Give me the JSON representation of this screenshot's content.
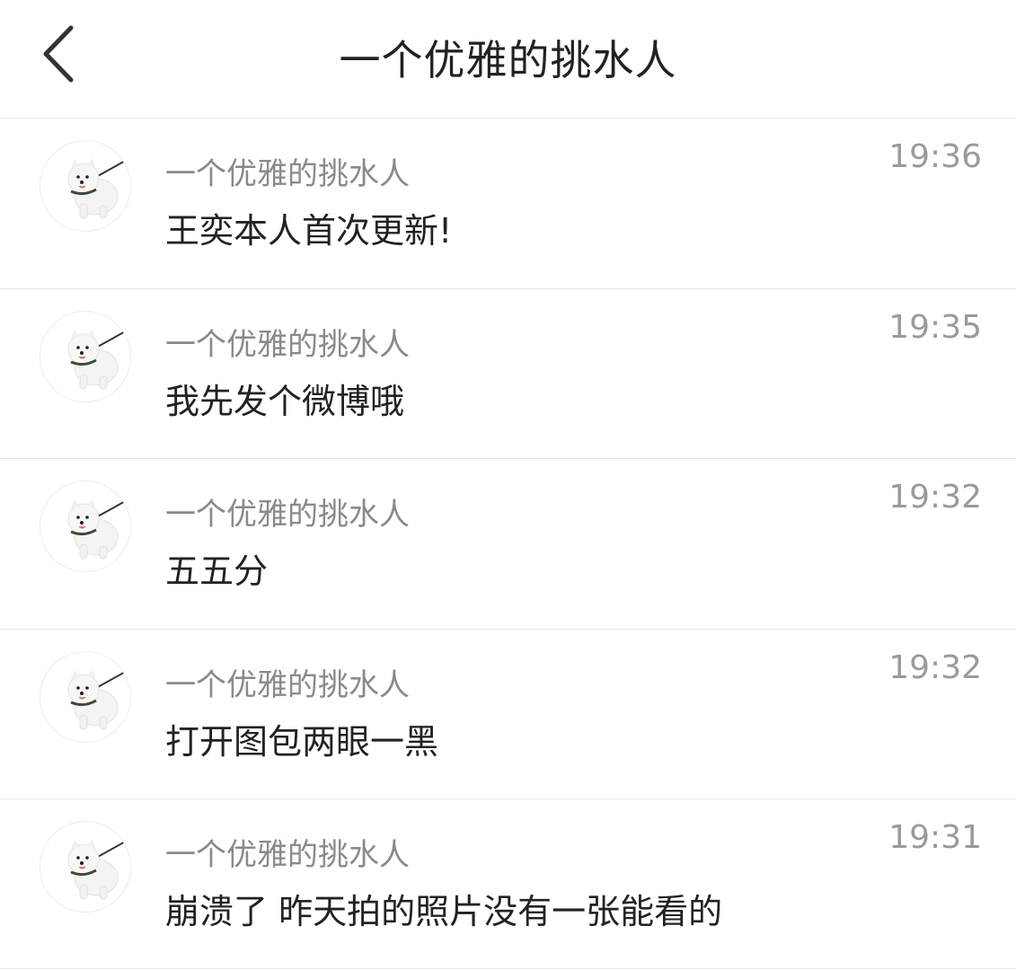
{
  "header": {
    "back_icon": "chevron-left-icon",
    "title": "一个优雅的挑水人"
  },
  "messages": [
    {
      "sender": "一个优雅的挑水人",
      "text": "王奕本人首次更新!",
      "time": "19:36",
      "avatar_icon": "white-dog-avatar-icon"
    },
    {
      "sender": "一个优雅的挑水人",
      "text": "我先发个微博哦",
      "time": "19:35",
      "avatar_icon": "white-dog-avatar-icon"
    },
    {
      "sender": "一个优雅的挑水人",
      "text": "五五分",
      "time": "19:32",
      "avatar_icon": "white-dog-avatar-icon"
    },
    {
      "sender": "一个优雅的挑水人",
      "text": "打开图包两眼一黑",
      "time": "19:32",
      "avatar_icon": "white-dog-avatar-icon"
    },
    {
      "sender": "一个优雅的挑水人",
      "text": "崩溃了 昨天拍的照片没有一张能看的",
      "time": "19:31",
      "avatar_icon": "white-dog-avatar-icon"
    }
  ],
  "colors": {
    "title": "#222222",
    "sender": "#8a8a8a",
    "time": "#9a9a9a",
    "divider": "#e6e6e6"
  }
}
